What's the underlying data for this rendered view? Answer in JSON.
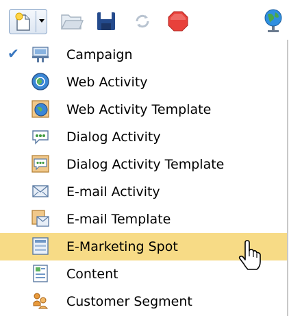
{
  "toolbar": {
    "buttons": [
      {
        "name": "new",
        "icon": "new-document-icon",
        "dropdown": "chevron-down-icon"
      },
      {
        "name": "open",
        "icon": "folder-open-icon"
      },
      {
        "name": "save",
        "icon": "save-icon"
      },
      {
        "name": "refresh",
        "icon": "refresh-icon"
      },
      {
        "name": "stop",
        "icon": "stop-icon"
      },
      {
        "name": "web",
        "icon": "globe-icon"
      }
    ]
  },
  "menu": {
    "items": [
      {
        "label": "Campaign",
        "icon": "campaign-icon",
        "checked": true
      },
      {
        "label": "Web Activity",
        "icon": "web-activity-icon"
      },
      {
        "label": "Web Activity Template",
        "icon": "web-activity-template-icon"
      },
      {
        "label": "Dialog Activity",
        "icon": "dialog-activity-icon"
      },
      {
        "label": "Dialog Activity Template",
        "icon": "dialog-activity-template-icon"
      },
      {
        "label": "E-mail Activity",
        "icon": "email-activity-icon"
      },
      {
        "label": "E-mail Template",
        "icon": "email-template-icon"
      },
      {
        "label": "E-Marketing Spot",
        "icon": "e-marketing-spot-icon",
        "highlighted": true
      },
      {
        "label": "Content",
        "icon": "content-icon"
      },
      {
        "label": "Customer Segment",
        "icon": "customer-segment-icon"
      }
    ]
  },
  "colors": {
    "highlight": "#f7db86",
    "check": "#3a78c0"
  }
}
